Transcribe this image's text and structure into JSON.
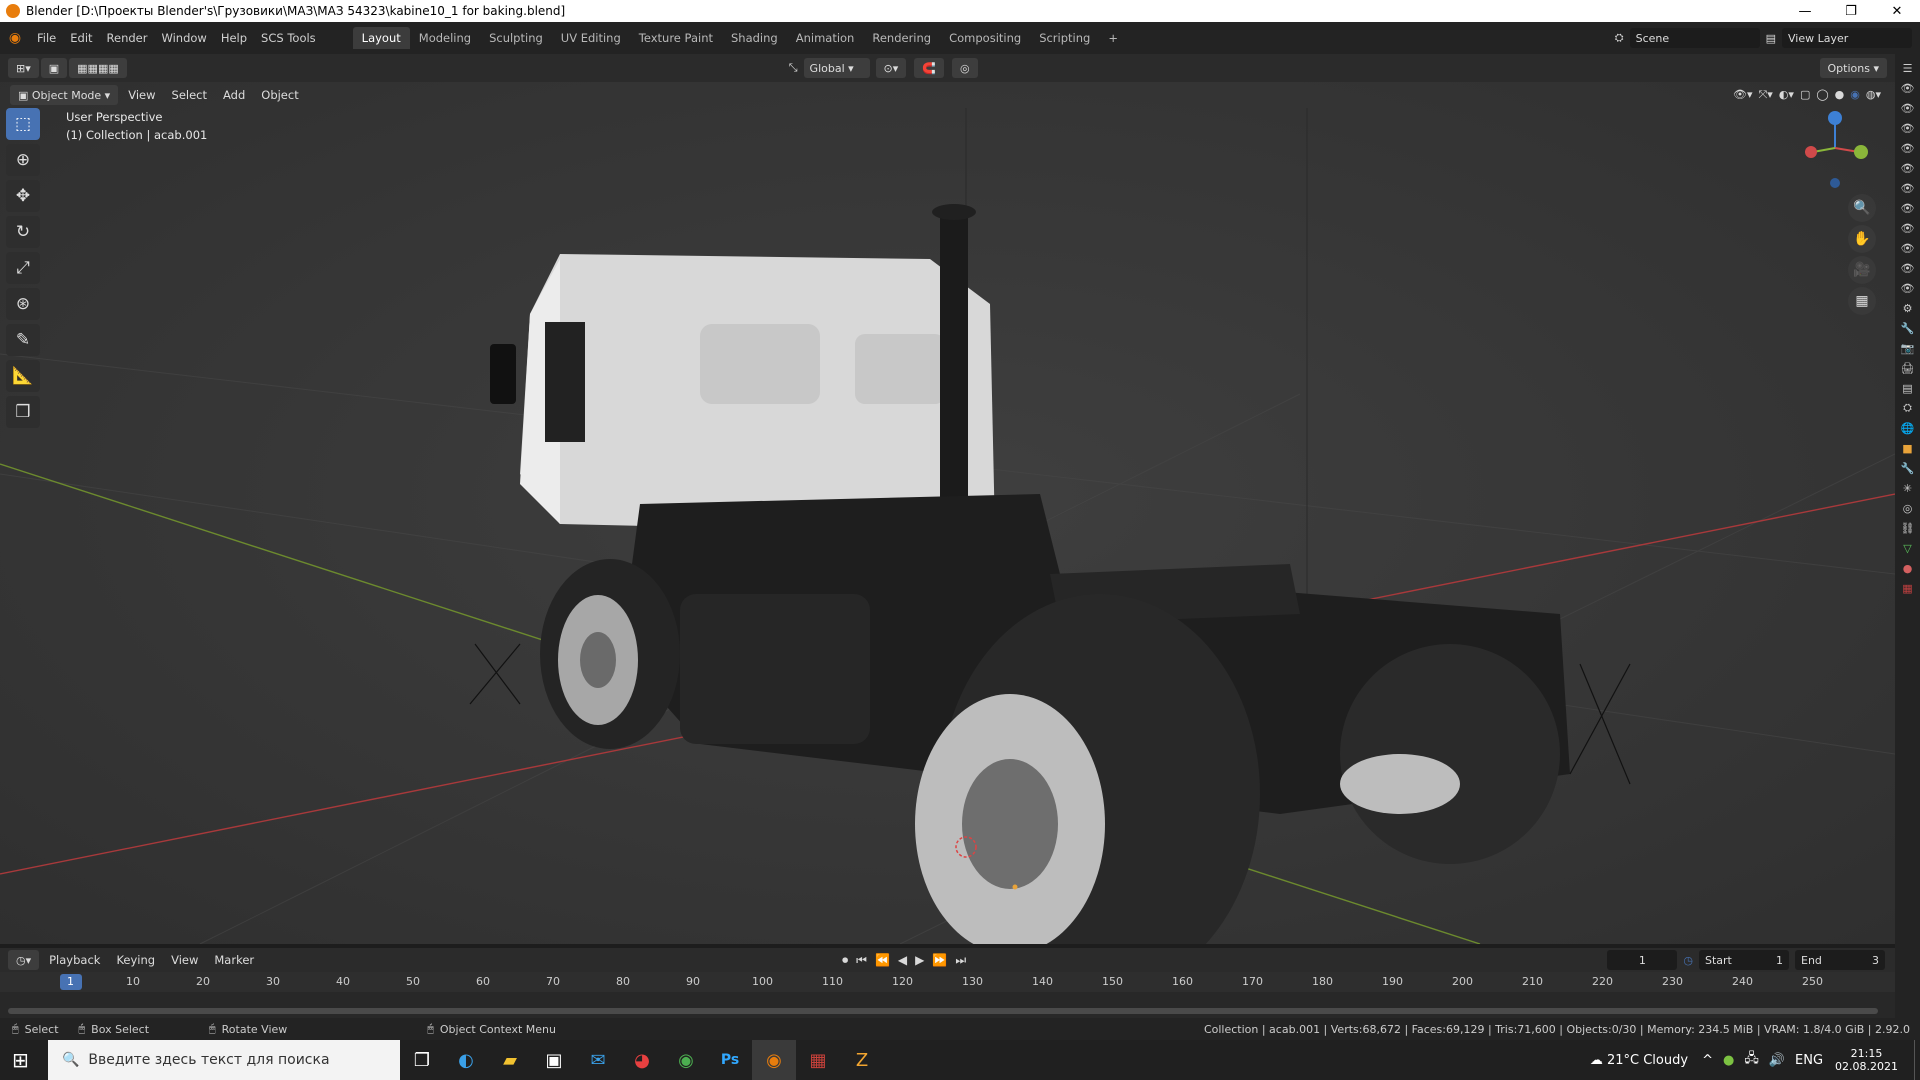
{
  "window": {
    "title": "Blender [D:\\Проекты Blender's\\Грузовики\\МАЗ\\МАЗ 54323\\kabine10_1 for baking.blend]",
    "minimize": "—",
    "restore": "❐",
    "close": "✕"
  },
  "menubar": {
    "items": [
      "File",
      "Edit",
      "Render",
      "Window",
      "Help",
      "SCS Tools"
    ]
  },
  "workspaces": [
    "Layout",
    "Modeling",
    "Sculpting",
    "UV Editing",
    "Texture Paint",
    "Shading",
    "Animation",
    "Rendering",
    "Compositing",
    "Scripting"
  ],
  "scene": {
    "name": "Scene",
    "view_layer": "View Layer"
  },
  "header2": {
    "transform_orientation": "Global",
    "options": "Options"
  },
  "viewport_header": {
    "mode": "Object Mode",
    "menus": [
      "View",
      "Select",
      "Add",
      "Object"
    ]
  },
  "viewport_overlay": {
    "line1": "User Perspective",
    "line2": "(1) Collection | acab.001"
  },
  "timeline": {
    "menus": [
      "Playback",
      "Keying",
      "View",
      "Marker"
    ],
    "current_frame": "1",
    "start_label": "Start",
    "start": "1",
    "end_label": "End",
    "end": "3",
    "ticks": [
      "1",
      "10",
      "20",
      "30",
      "40",
      "50",
      "60",
      "70",
      "80",
      "90",
      "100",
      "110",
      "120",
      "130",
      "140",
      "150",
      "160",
      "170",
      "180",
      "190",
      "200",
      "210",
      "220",
      "230",
      "240",
      "250"
    ]
  },
  "status": {
    "select": "Select",
    "box_select": "Box Select",
    "rotate_view": "Rotate View",
    "context_menu": "Object Context Menu",
    "stats": "Collection | acab.001 | Verts:68,672 | Faces:69,129 | Tris:71,600 | Objects:0/30 | Memory: 234.5 MiB | VRAM: 1.8/4.0 GiB | 2.92.0"
  },
  "taskbar": {
    "search_placeholder": "Введите здесь текст для поиска",
    "weather": "21°C  Cloudy",
    "lang": "ENG",
    "time": "21:15",
    "date": "02.08.2021"
  },
  "colors": {
    "accent": "#4772b3",
    "timeline_cursor": "#4772b3",
    "x_axis": "#d04a4a",
    "y_axis": "#8ab63a",
    "z_axis": "#3d80d5"
  }
}
